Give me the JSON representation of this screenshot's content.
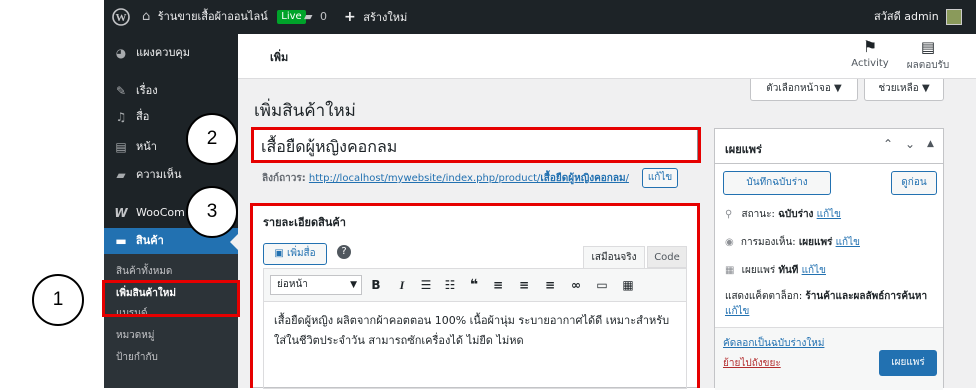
{
  "adminbar": {
    "site_name": "ร้านขายเสื้อผ้าออนไลน์",
    "live_badge": "Live",
    "comments_count": "0",
    "new_label": "สร้างใหม่",
    "greeting": "สวัสดี admin"
  },
  "sidebar": {
    "items": [
      {
        "icon": "dashboard-icon",
        "label": "แผงควบคุม"
      },
      {
        "icon": "pin-icon",
        "label": "เรื่อง"
      },
      {
        "icon": "media-icon",
        "label": "สื่อ"
      },
      {
        "icon": "pages-icon",
        "label": "หน้า"
      },
      {
        "icon": "comments-icon",
        "label": "ความเห็น"
      },
      {
        "icon": "woocommerce-icon",
        "label": "WooCom"
      },
      {
        "icon": "products-icon",
        "label": "สินค้า"
      }
    ],
    "submenu": [
      "สินค้าทั้งหมด",
      "เพิ่มสินค้าใหม่",
      "แบรนด์",
      "หมวดหมู่",
      "ป้ายกำกับ"
    ]
  },
  "header": {
    "title": "เพิ่ม",
    "activity_label": "Activity",
    "feedback_label": "ผลตอบรับ"
  },
  "screen_options_label": "ตัวเลือกหน้าจอ ▼",
  "help_label": "ช่วยเหลือ ▼",
  "page_title": "เพิ่มสินค้าใหม่",
  "product_title": "เสื้อยืดผู้หญิงคอกลม",
  "permalink": {
    "label": "ลิงก์ถาวร:",
    "base": "http://localhost/mywebsite/index.php/product/",
    "slug": "เสื้อยืดผู้หญิงคอกลม",
    "tail": "/",
    "edit_label": "แก้ไข"
  },
  "description_box": {
    "heading": "รายละเอียดสินค้า",
    "add_media_label": "เพิ่มสื่อ",
    "tab_visual": "เสมือนจริง",
    "tab_code": "Code",
    "format_select": "ย่อหน้า",
    "content": "เสื้อยืดผู้หญิง ผลิตจากผ้าคอตตอน 100% เนื้อผ้านุ่ม ระบายอากาศได้ดี เหมาะสำหรับใส่ในชีวิตประจำวัน สามารถซักเครื่องได้ ไม่ยืด ไม่หด"
  },
  "publish_box": {
    "heading": "เผยแพร่",
    "save_draft": "บันทึกฉบับร่าง",
    "preview": "ดูก่อน",
    "status_label": "สถานะ:",
    "status_value": "ฉบับร่าง",
    "visibility_label": "การมองเห็น:",
    "visibility_value": "เผยแพร่",
    "publish_label": "เผยแพร่",
    "publish_value": "ทันที",
    "edit_link": "แก้ไข",
    "catalog_label": "แสดงแค็ตตาล็อก:",
    "catalog_value": "ร้านค้าและผลลัพธ์การค้นหา",
    "copy_draft": "คัดลอกเป็นฉบับร่างใหม่",
    "trash": "ย้ายไปถังขยะ",
    "publish_button": "เผยแพร่"
  },
  "annotations": {
    "one": "1",
    "two": "2",
    "three": "3"
  },
  "colors": {
    "adminbar": "#1d2327",
    "accent": "#2271b1",
    "highlight": "#e60000",
    "live": "#00a32a"
  }
}
